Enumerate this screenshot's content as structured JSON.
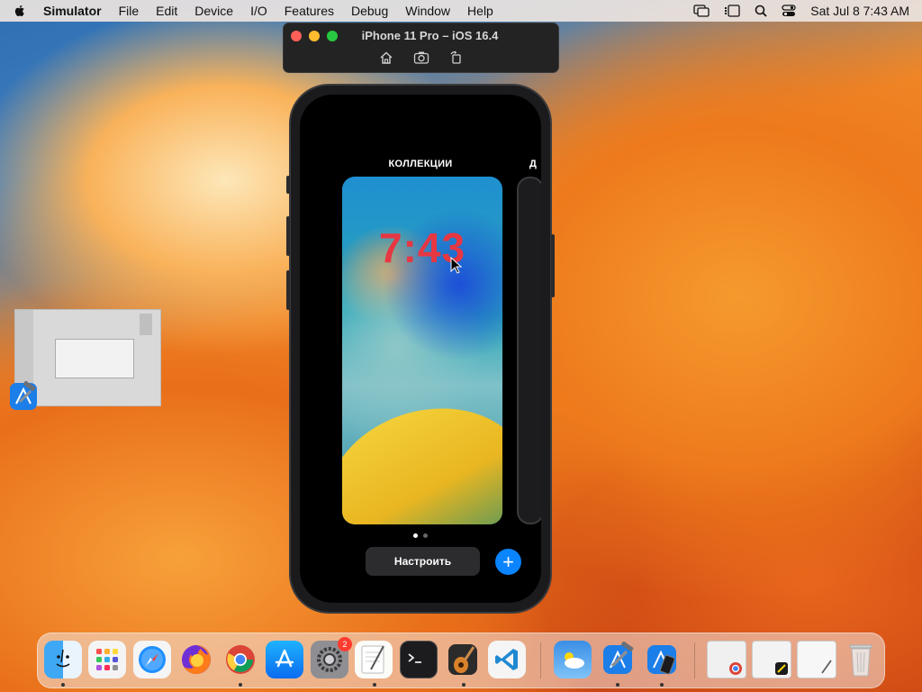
{
  "menubar": {
    "app": "Simulator",
    "items": [
      "File",
      "Edit",
      "Device",
      "I/O",
      "Features",
      "Debug",
      "Window",
      "Help"
    ],
    "clock": "Sat Jul 8  7:43 AM"
  },
  "simulator": {
    "title": "iPhone 11 Pro – iOS 16.4"
  },
  "phone": {
    "collections_title": "КОЛЛЕКЦИИ",
    "side_letter": "Д",
    "lock_time": "7:43",
    "customize_label": "Настроить",
    "add_label": "+"
  },
  "dock": {
    "settings_badge": "2"
  },
  "colors": {
    "accent": "#0a84ff",
    "lock_red": "#e63743",
    "close": "#ff5f57",
    "minimize": "#febc2e",
    "zoom": "#28c840"
  }
}
